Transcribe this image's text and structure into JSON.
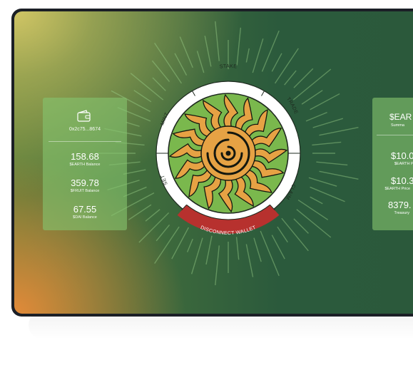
{
  "wallet": {
    "address": "0x2c75...8674",
    "stats": [
      {
        "value": "158.68",
        "label": "$EARTH Balance"
      },
      {
        "value": "359.78",
        "label": "$FRUIT Balance"
      },
      {
        "value": "67.55",
        "label": "$DAI Balance"
      }
    ]
  },
  "wheel": {
    "segments": [
      "STAKE",
      "TRADE",
      "CLAIM",
      "SET",
      "MINT"
    ],
    "disconnect_label": "DISCONNECT WALLET"
  },
  "summary": {
    "title": "$EAR",
    "subtitle": "Summa",
    "stats": [
      {
        "value": "$10.0",
        "label": "$EARTH P"
      },
      {
        "value": "$10.3",
        "label": "$EARTH Price"
      },
      {
        "value": "8379.",
        "label": "Treasury"
      }
    ]
  },
  "colors": {
    "disconnect": "#b7312e",
    "petal_orange": "#e6a244",
    "petal_outline": "#14170f",
    "panel": "#85c46e"
  }
}
